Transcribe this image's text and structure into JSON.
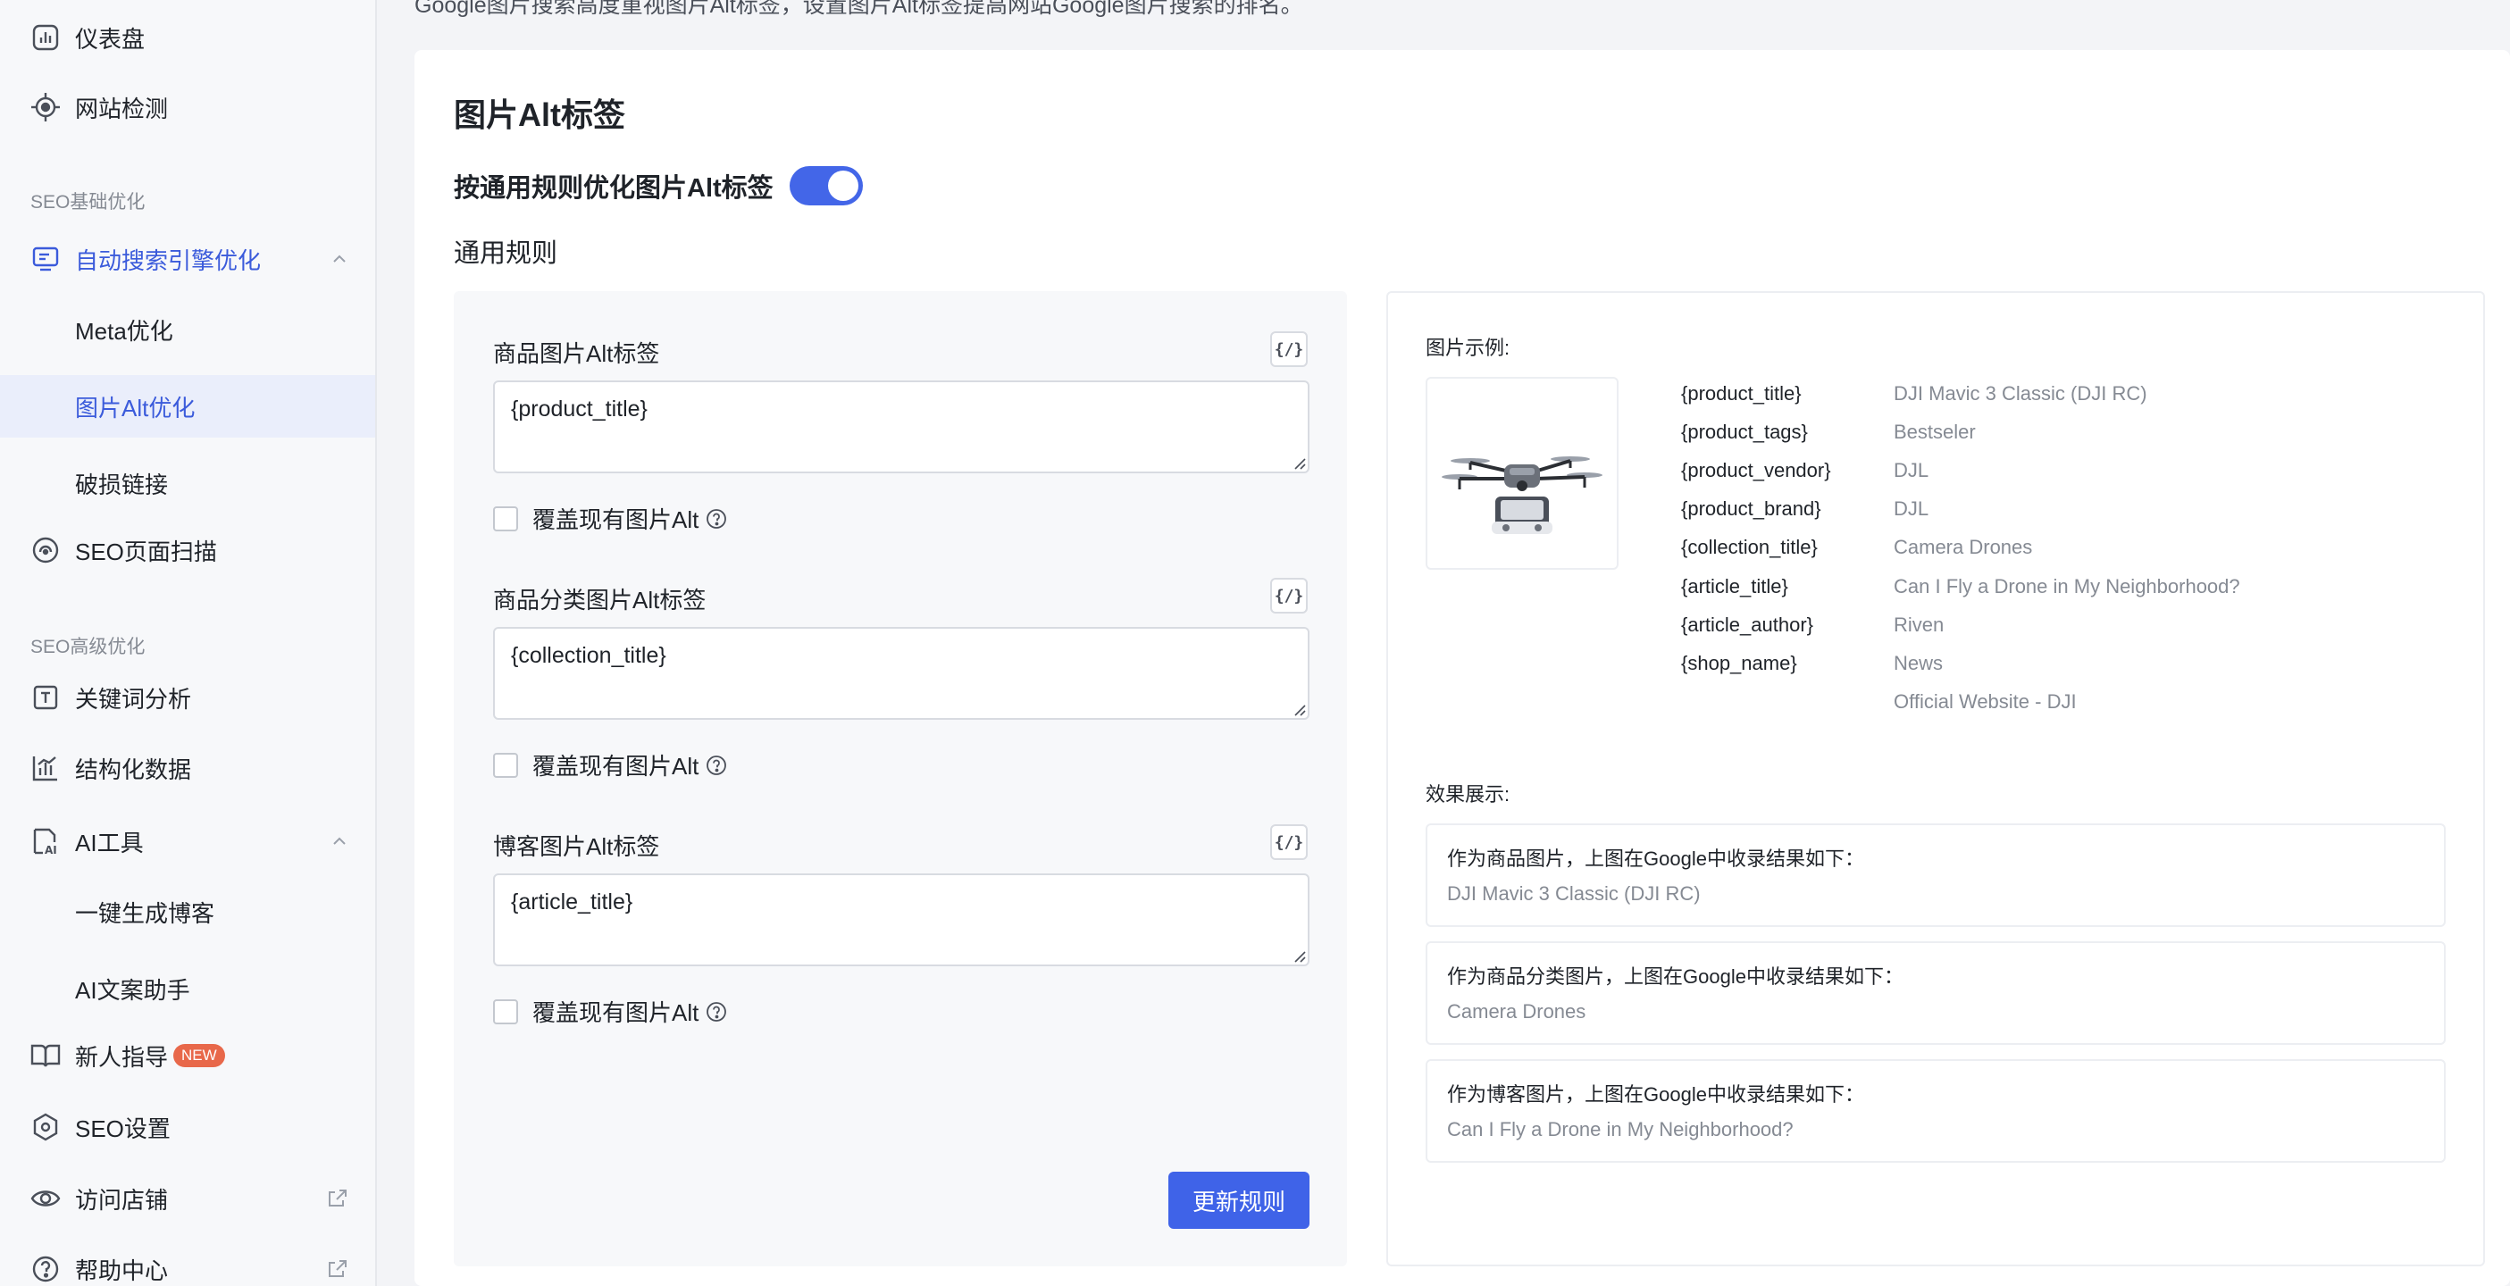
{
  "sidebar": {
    "items": [
      {
        "label": "仪表盘",
        "icon": "dashboard-icon"
      },
      {
        "label": "网站检测",
        "icon": "target-icon"
      }
    ],
    "section_basic": "SEO基础优化",
    "auto_seo": {
      "label": "自动搜索引擎优化",
      "icon": "monitor-icon"
    },
    "auto_seo_children": [
      "Meta优化",
      "图片Alt优化",
      "破损链接"
    ],
    "page_scan": {
      "label": "SEO页面扫描",
      "icon": "scan-icon"
    },
    "section_advanced": "SEO高级优化",
    "keyword": {
      "label": "关键词分析",
      "icon": "text-box-icon"
    },
    "structured": {
      "label": "结构化数据",
      "icon": "bar-chart-icon"
    },
    "ai_tools": {
      "label": "AI工具",
      "icon": "ai-doc-icon"
    },
    "ai_children": [
      "一键生成博客",
      "AI文案助手"
    ],
    "guide": {
      "label": "新人指导",
      "badge": "NEW",
      "icon": "book-icon"
    },
    "seo_settings": {
      "label": "SEO设置",
      "icon": "hexagon-settings-icon"
    },
    "visit_store": {
      "label": "访问店铺",
      "icon": "eye-icon"
    },
    "help": {
      "label": "帮助中心",
      "icon": "question-circle-icon"
    }
  },
  "top_note": "Google图片搜索高度重视图片Alt标签，设置图片Alt标签提高网站Google图片搜索的排名。",
  "main": {
    "title": "图片Alt标签",
    "switch_label": "按通用规则优化图片Alt标签",
    "switch_on": true,
    "rules_title": "通用规则",
    "var_button": "{/}",
    "fields": [
      {
        "label": "商品图片Alt标签",
        "value": "{product_title}",
        "override": "覆盖现有图片Alt"
      },
      {
        "label": "商品分类图片Alt标签",
        "value": "{collection_title}",
        "override": "覆盖现有图片Alt"
      },
      {
        "label": "博客图片Alt标签",
        "value": "{article_title}",
        "override": "覆盖现有图片Alt"
      }
    ],
    "update_button": "更新规则"
  },
  "preview": {
    "example_label": "图片示例:",
    "variables": [
      {
        "key": "{product_title}",
        "value": "DJI Mavic 3 Classic (DJI RC)"
      },
      {
        "key": "{product_tags}",
        "value": "Bestseler"
      },
      {
        "key": "{product_vendor}",
        "value": "DJL"
      },
      {
        "key": "{product_brand}",
        "value": "DJL"
      },
      {
        "key": "{collection_title}",
        "value": "Camera Drones"
      },
      {
        "key": "{article_title}",
        "value": "Can I Fly a Drone in My Neighborhood?"
      },
      {
        "key": "{article_author}",
        "value": "Riven"
      },
      {
        "key": "{shop_name}",
        "value": "News"
      },
      {
        "key": "",
        "value": "Official Website - DJI"
      }
    ],
    "effect_label": "效果展示:",
    "results": [
      {
        "title": "作为商品图片，上图在Google中收录结果如下：",
        "value": "DJI Mavic 3 Classic (DJI RC)"
      },
      {
        "title": "作为商品分类图片，上图在Google中收录结果如下：",
        "value": "Camera Drones"
      },
      {
        "title": "作为博客图片，上图在Google中收录结果如下：",
        "value": "Can I Fly a Drone in My Neighborhood?"
      }
    ]
  },
  "colors": {
    "accent": "#3f63e8",
    "badge": "#e8684a"
  }
}
